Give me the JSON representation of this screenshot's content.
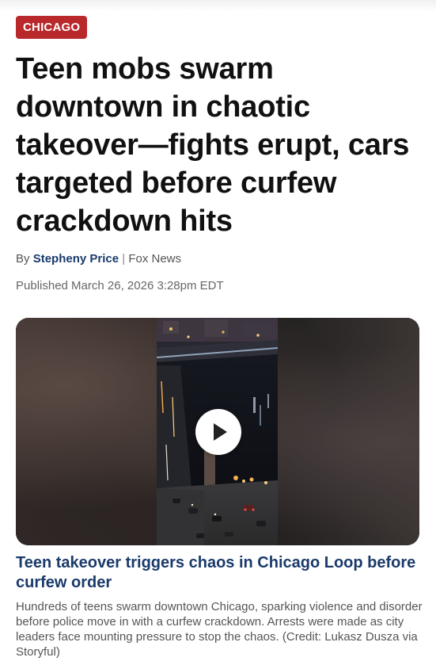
{
  "category_badge": "CHICAGO",
  "headline": "Teen mobs swarm downtown in chaotic takeover—fights erupt, cars targeted before curfew crackdown hits",
  "byline": {
    "prefix": "By",
    "author": "Stepheny Price",
    "separator": "|",
    "source": "Fox News"
  },
  "published": "Published March 26, 2026 3:28pm EDT",
  "video": {
    "play_icon": "play-icon",
    "title": "Teen takeover triggers chaos in Chicago Loop before curfew order",
    "caption": "Hundreds of teens swarm downtown Chicago, sparking violence and disorder before police move in with a curfew crackdown. Arrests were made as city leaders face mounting pressure to stop the chaos. (Credit: Lukasz Dusza via Storyful)"
  },
  "colors": {
    "badge": "#b9282b",
    "link": "#1a3a6b",
    "headline": "#111111"
  }
}
